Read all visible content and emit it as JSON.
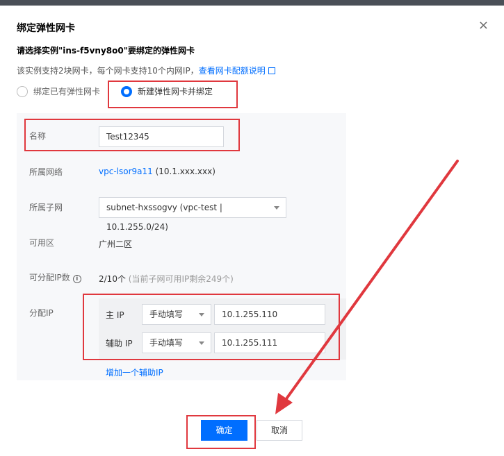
{
  "dialog": {
    "title": "绑定弹性网卡",
    "close_symbol": "×"
  },
  "heading": "请选择实例\"ins-f5vny8o0\"要绑定的弹性网卡",
  "hint": {
    "text": "该实例支持2块网卡，每个网卡支持10个内网IP，",
    "link": "查看网卡配额说明"
  },
  "radio": {
    "existing_label": "绑定已有弹性网卡",
    "new_label": "新建弹性网卡并绑定",
    "selected": "new"
  },
  "form": {
    "name_label": "名称",
    "name_value": "Test12345",
    "vpc_label": "所属网络",
    "vpc_link": "vpc-lsor9a11",
    "vpc_cidr": "(10.1.xxx.xxx)",
    "subnet_label": "所属子网",
    "subnet_value": "subnet-hxssogvy (vpc-test | 10.1.255.0/24)",
    "zone_label": "可用区",
    "zone_value": "广州二区",
    "ip_count_label": "可分配IP数",
    "ip_count_value": "2/10个",
    "ip_count_note": "(当前子网可用IP剩余249个)",
    "assign_ip_label": "分配IP",
    "primary_ip_label": "主 IP",
    "primary_ip_mode": "手动填写",
    "primary_ip_value": "10.1.255.110",
    "secondary_ip_label": "辅助 IP",
    "secondary_ip_mode": "手动填写",
    "secondary_ip_value": "10.1.255.111",
    "add_secondary_ip": "增加一个辅助IP"
  },
  "buttons": {
    "confirm": "确定",
    "cancel": "取消"
  },
  "colors": {
    "accent": "#006eff",
    "annotation_red": "#e0383e"
  }
}
